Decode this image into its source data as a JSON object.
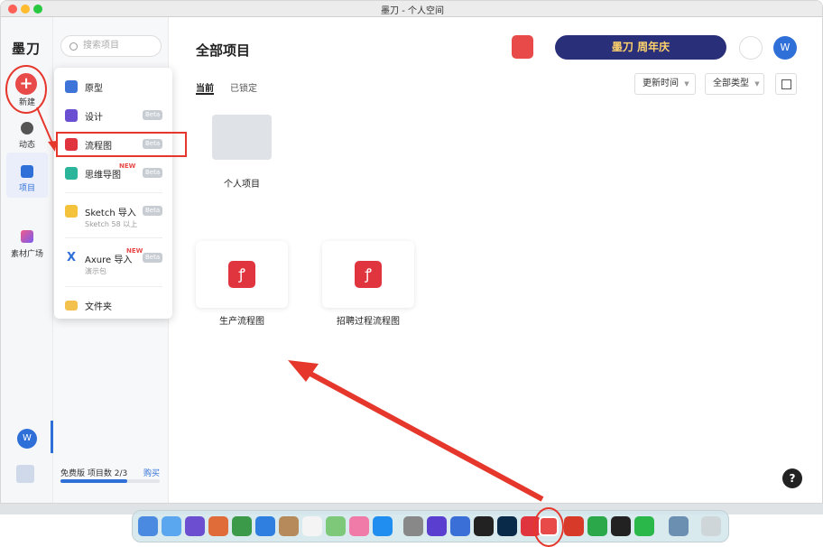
{
  "window": {
    "title": "墨刀 - 个人空间"
  },
  "rail": {
    "logo": "墨刀",
    "new_label": "新建",
    "items": [
      {
        "label": "动态"
      },
      {
        "label": "项目"
      },
      {
        "label": "素材广场"
      }
    ],
    "avatar": "W"
  },
  "sidebar": {
    "search_placeholder": "搜索项目",
    "quota": "免费版 项目数 2/3",
    "buy": "购买",
    "quota_progress": 0.67
  },
  "new_menu": {
    "items": [
      {
        "label": "原型",
        "badge": ""
      },
      {
        "label": "设计",
        "badge": "Beta"
      },
      {
        "label": "流程图",
        "badge": "Beta"
      },
      {
        "label": "思维导图",
        "badge": "Beta",
        "tag": "NEW"
      },
      {
        "label": "Sketch 导入",
        "badge": "Beta",
        "sub": "Sketch 58 以上"
      },
      {
        "label": "Axure 导入",
        "badge": "Beta",
        "sub": "演示包",
        "tag": "NEW"
      },
      {
        "label": "文件夹",
        "badge": ""
      }
    ]
  },
  "main": {
    "title": "全部项目",
    "tabs": [
      "当前",
      "已锁定"
    ],
    "sort_label": "更新时间",
    "type_label": "全部类型",
    "folder_label": "个人项目",
    "projects": [
      {
        "name": "生产流程图"
      },
      {
        "name": "招聘过程流程图"
      }
    ],
    "banner_text": "墨刀 周年庆",
    "avatar": "W",
    "help": "?"
  },
  "colors": {
    "accent": "#2f6fd8",
    "brand_red": "#e0343e",
    "annotation_red": "#e5372c"
  }
}
